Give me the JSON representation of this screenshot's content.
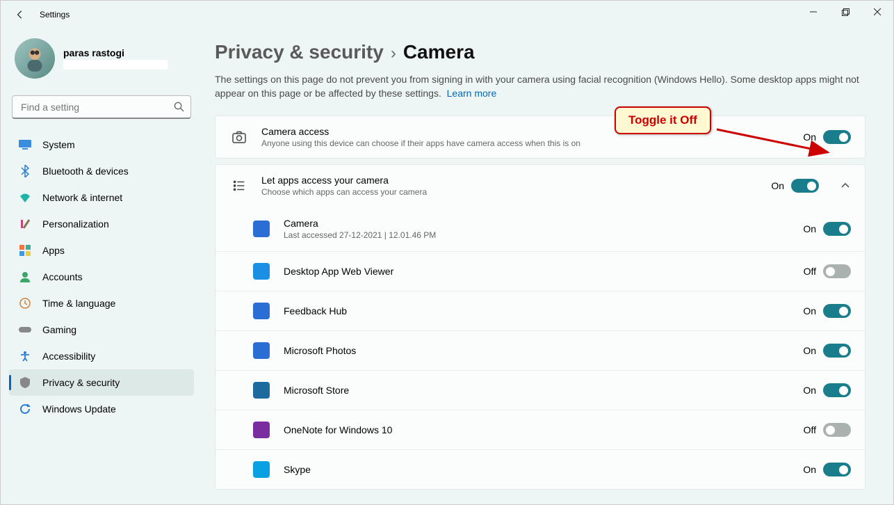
{
  "window": {
    "app_title": "Settings"
  },
  "profile": {
    "name": "paras rastogi"
  },
  "search": {
    "placeholder": "Find a setting"
  },
  "nav": [
    {
      "label": "System",
      "key": "system"
    },
    {
      "label": "Bluetooth & devices",
      "key": "bluetooth"
    },
    {
      "label": "Network & internet",
      "key": "network"
    },
    {
      "label": "Personalization",
      "key": "personalization"
    },
    {
      "label": "Apps",
      "key": "apps"
    },
    {
      "label": "Accounts",
      "key": "accounts"
    },
    {
      "label": "Time & language",
      "key": "time"
    },
    {
      "label": "Gaming",
      "key": "gaming"
    },
    {
      "label": "Accessibility",
      "key": "accessibility"
    },
    {
      "label": "Privacy & security",
      "key": "privacy",
      "selected": true
    },
    {
      "label": "Windows Update",
      "key": "update"
    }
  ],
  "breadcrumb": {
    "parent": "Privacy & security",
    "current": "Camera"
  },
  "description": "The settings on this page do not prevent you from signing in with your camera using facial recognition (Windows Hello). Some desktop apps might not appear on this page or be affected by these settings.",
  "learn_more": "Learn more",
  "callout": "Toggle it Off",
  "camera_access": {
    "title": "Camera access",
    "subtitle": "Anyone using this device can choose if their apps have camera access when this is on",
    "state": "On"
  },
  "apps_access": {
    "title": "Let apps access your camera",
    "subtitle": "Choose which apps can access your camera",
    "state": "On"
  },
  "on_label": "On",
  "off_label": "Off",
  "apps": [
    {
      "name": "Camera",
      "sub": "Last accessed 27-12-2021  |  12.01.46 PM",
      "state": "On",
      "color": "#2a6dd4"
    },
    {
      "name": "Desktop App Web Viewer",
      "sub": "",
      "state": "Off",
      "color": "#1a8fe3"
    },
    {
      "name": "Feedback Hub",
      "sub": "",
      "state": "On",
      "color": "#2a6dd4"
    },
    {
      "name": "Microsoft Photos",
      "sub": "",
      "state": "On",
      "color": "#2a6dd4"
    },
    {
      "name": "Microsoft Store",
      "sub": "",
      "state": "On",
      "color": "#1d6b9e"
    },
    {
      "name": "OneNote for Windows 10",
      "sub": "",
      "state": "Off",
      "color": "#7a2d9e"
    },
    {
      "name": "Skype",
      "sub": "",
      "state": "On",
      "color": "#0aa1e2"
    }
  ]
}
